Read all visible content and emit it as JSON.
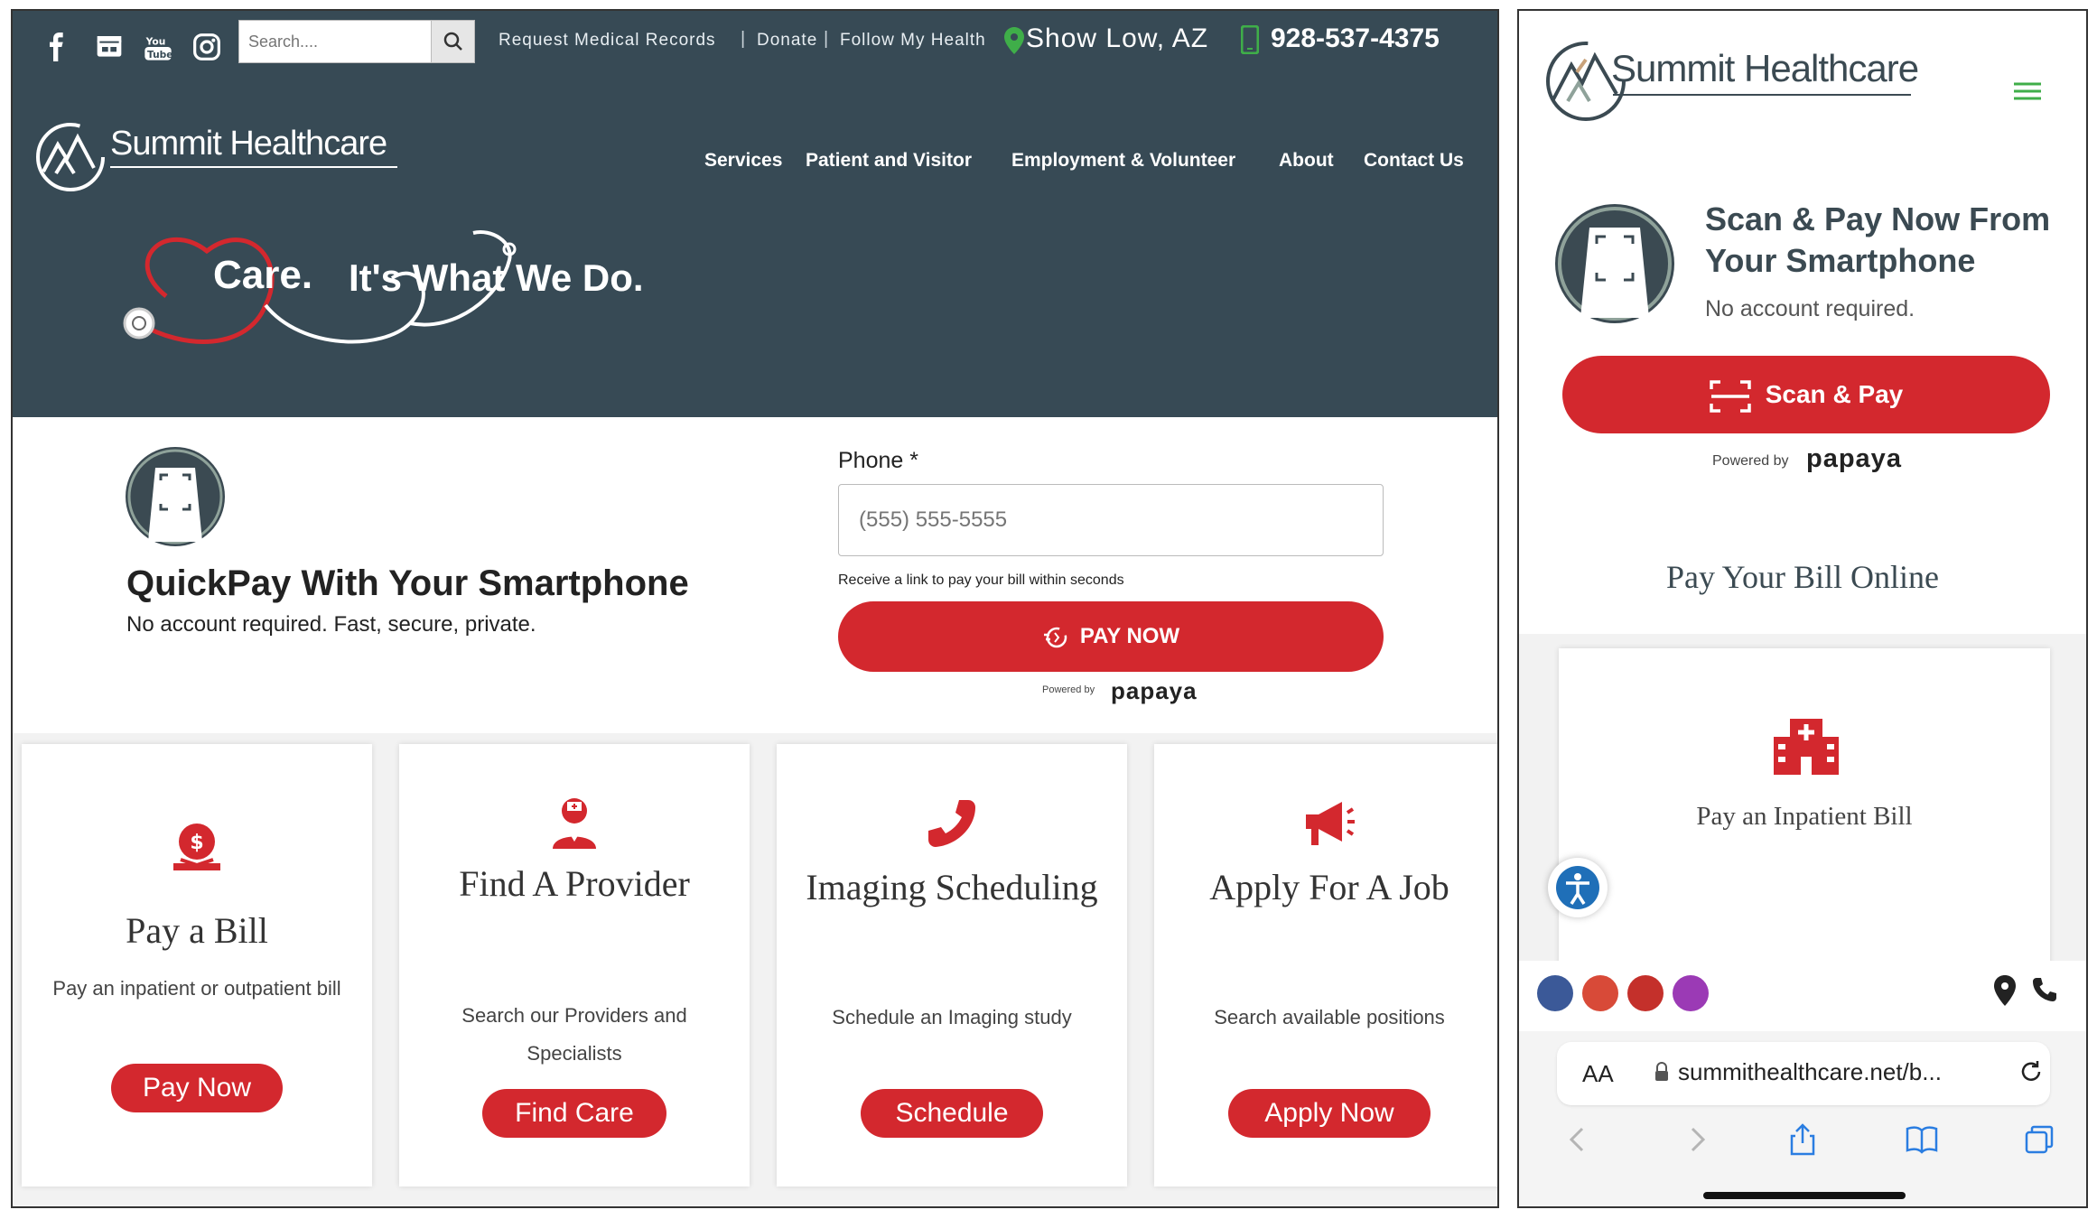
{
  "desktop": {
    "search_placeholder": "Search....",
    "top_links": [
      "Request Medical Records",
      "Donate",
      "Follow My Health"
    ],
    "location": "Show Low, AZ",
    "phone": "928-537-4375",
    "brand": "Summit Healthcare",
    "nav": [
      "Services",
      "Patient and Visitor",
      "Employment & Volunteer",
      "About",
      "Contact Us"
    ],
    "tagline_1": "Care.",
    "tagline_2": "It's What We Do.",
    "quickpay": {
      "title": "QuickPay With Your Smartphone",
      "subtitle": "No account required. Fast, secure, private.",
      "phone_label": "Phone *",
      "phone_placeholder": "(555) 555-5555",
      "help": "Receive a link to pay your bill within seconds",
      "button": "PAY NOW",
      "powered_by": "Powered by",
      "papaya": "papaya"
    },
    "cards": [
      {
        "title": "Pay a Bill",
        "desc": "Pay an inpatient or outpatient bill",
        "button": "Pay Now",
        "icon": "money-bag-icon"
      },
      {
        "title": "Find A Provider",
        "desc": "Search our Providers and Specialists",
        "button": "Find Care",
        "icon": "doctor-icon"
      },
      {
        "title": "Imaging Scheduling",
        "desc": "Schedule an Imaging study",
        "button": "Schedule",
        "icon": "phone-icon"
      },
      {
        "title": "Apply For A Job",
        "desc": "Search available positions",
        "button": "Apply Now",
        "icon": "megaphone-icon"
      }
    ]
  },
  "mobile": {
    "brand": "Summit Healthcare",
    "scan_title": "Scan & Pay Now From Your Smartphone",
    "scan_sub": "No account required.",
    "scan_button": "Scan & Pay",
    "powered_by": "Powered by",
    "papaya": "papaya",
    "pay_online": "Pay Your Bill Online",
    "inpatient": "Pay an Inpatient Bill",
    "aa": "AA",
    "url": "summithealthcare.net/b..."
  },
  "colors": {
    "header": "#374a55",
    "accent": "#d3282e",
    "brand_text": "#3b4a52"
  }
}
